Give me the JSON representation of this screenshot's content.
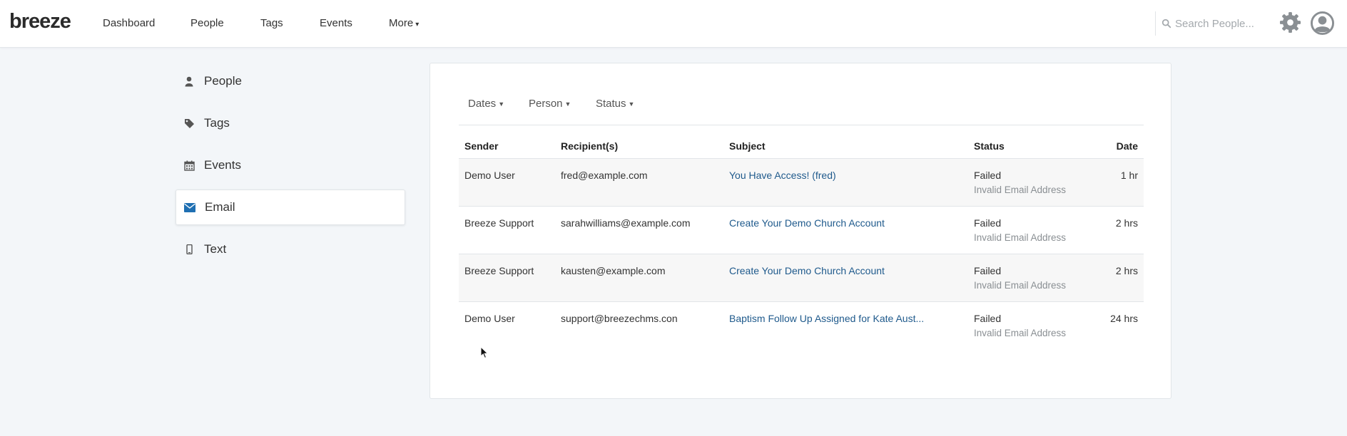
{
  "brand": {
    "logo_text": "breeze"
  },
  "nav": {
    "items": [
      "Dashboard",
      "People",
      "Tags",
      "Events",
      "More"
    ]
  },
  "search": {
    "placeholder": "Search People..."
  },
  "sidebar": {
    "items": [
      {
        "label": "People",
        "icon": "person-icon"
      },
      {
        "label": "Tags",
        "icon": "tag-icon"
      },
      {
        "label": "Events",
        "icon": "calendar-icon"
      },
      {
        "label": "Email",
        "icon": "envelope-icon",
        "active": true
      },
      {
        "label": "Text",
        "icon": "mobile-phone-icon"
      }
    ]
  },
  "filters": [
    "Dates",
    "Person",
    "Status"
  ],
  "table": {
    "headers": [
      "Sender",
      "Recipient(s)",
      "Subject",
      "Status",
      "Date"
    ],
    "rows": [
      {
        "sender": "Demo User",
        "recipient": "fred@example.com",
        "subject": "You Have Access! (fred)",
        "status": "Failed",
        "status_detail": "Invalid Email Address",
        "date": "1 hr"
      },
      {
        "sender": "Breeze Support",
        "recipient": "sarahwilliams@example.com",
        "subject": "Create Your Demo Church Account",
        "status": "Failed",
        "status_detail": "Invalid Email Address",
        "date": "2 hrs"
      },
      {
        "sender": "Breeze Support",
        "recipient": "kausten@example.com",
        "subject": "Create Your Demo Church Account",
        "status": "Failed",
        "status_detail": "Invalid Email Address",
        "date": "2 hrs"
      },
      {
        "sender": "Demo User",
        "recipient": "support@breezechms.con",
        "subject": "Baptism Follow Up Assigned for Kate Aust...",
        "status": "Failed",
        "status_detail": "Invalid Email Address",
        "date": "24 hrs"
      }
    ]
  },
  "colors": {
    "background": "#f3f6f9",
    "link": "#1f5a8c",
    "active_icon": "#1f6fb2",
    "muted": "#8a8f93"
  }
}
